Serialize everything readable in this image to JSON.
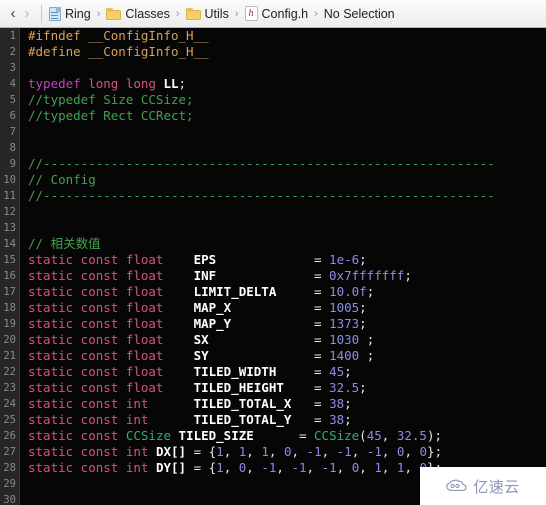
{
  "jumpbar": {
    "back_glyph": "‹",
    "forward_glyph": "›",
    "separator_glyph": "›",
    "crumbs": [
      {
        "icon": "document-icon",
        "label": "Ring"
      },
      {
        "icon": "folder-icon",
        "label": "Classes"
      },
      {
        "icon": "folder-icon",
        "label": "Utils"
      },
      {
        "icon": "header-file-icon",
        "label": "Config.h",
        "icon_letter": "h"
      },
      {
        "icon": "none",
        "label": "No Selection"
      }
    ]
  },
  "editor": {
    "first_line_number": 1,
    "line_numbers": [
      "1",
      "2",
      "3",
      "4",
      "5",
      "6",
      "7",
      "8",
      "9",
      "10",
      "11",
      "12",
      "13",
      "14",
      "15",
      "16",
      "17",
      "18",
      "19",
      "20",
      "21",
      "22",
      "23",
      "24",
      "25",
      "26",
      "27",
      "28",
      "29",
      "30"
    ],
    "lines": [
      {
        "n": "1",
        "tokens": [
          {
            "t": "#ifndef __ConfigInfo_H__",
            "c": "pre"
          }
        ]
      },
      {
        "n": "2",
        "tokens": [
          {
            "t": "#define __ConfigInfo_H__",
            "c": "pre"
          }
        ]
      },
      {
        "n": "3",
        "tokens": []
      },
      {
        "n": "4",
        "tokens": [
          {
            "t": "typedef",
            "c": "kw"
          },
          {
            "t": " ",
            "c": "plain"
          },
          {
            "t": "long long",
            "c": "type"
          },
          {
            "t": " ",
            "c": "plain"
          },
          {
            "t": "LL",
            "c": "id"
          },
          {
            "t": ";",
            "c": "plain"
          }
        ]
      },
      {
        "n": "5",
        "tokens": [
          {
            "t": "//typedef Size CCSize;",
            "c": "cmt"
          }
        ]
      },
      {
        "n": "6",
        "tokens": [
          {
            "t": "//typedef Rect CCRect;",
            "c": "cmt"
          }
        ]
      },
      {
        "n": "7",
        "tokens": []
      },
      {
        "n": "8",
        "tokens": []
      },
      {
        "n": "9",
        "tokens": [
          {
            "t": "//------------------------------------------------------------",
            "c": "cmt"
          }
        ]
      },
      {
        "n": "10",
        "tokens": [
          {
            "t": "// Config",
            "c": "cmt"
          }
        ]
      },
      {
        "n": "11",
        "tokens": [
          {
            "t": "//------------------------------------------------------------",
            "c": "cmt"
          }
        ]
      },
      {
        "n": "12",
        "tokens": []
      },
      {
        "n": "13",
        "tokens": []
      },
      {
        "n": "14",
        "tokens": [
          {
            "t": "// 相关数值",
            "c": "cmt"
          }
        ]
      },
      {
        "n": "15",
        "tokens": [
          {
            "t": "static const float",
            "c": "type"
          },
          {
            "t": "    ",
            "c": "plain"
          },
          {
            "t": "EPS",
            "c": "id"
          },
          {
            "t": "             = ",
            "c": "plain"
          },
          {
            "t": "1e-6",
            "c": "num"
          },
          {
            "t": ";",
            "c": "plain"
          }
        ]
      },
      {
        "n": "16",
        "tokens": [
          {
            "t": "static const float",
            "c": "type"
          },
          {
            "t": "    ",
            "c": "plain"
          },
          {
            "t": "INF",
            "c": "id"
          },
          {
            "t": "             = ",
            "c": "plain"
          },
          {
            "t": "0x7fffffff",
            "c": "num"
          },
          {
            "t": ";",
            "c": "plain"
          }
        ]
      },
      {
        "n": "17",
        "tokens": [
          {
            "t": "static const float",
            "c": "type"
          },
          {
            "t": "    ",
            "c": "plain"
          },
          {
            "t": "LIMIT_DELTA",
            "c": "id"
          },
          {
            "t": "     = ",
            "c": "plain"
          },
          {
            "t": "10.0f",
            "c": "num"
          },
          {
            "t": ";",
            "c": "plain"
          }
        ]
      },
      {
        "n": "18",
        "tokens": [
          {
            "t": "static const float",
            "c": "type"
          },
          {
            "t": "    ",
            "c": "plain"
          },
          {
            "t": "MAP_X",
            "c": "id"
          },
          {
            "t": "           = ",
            "c": "plain"
          },
          {
            "t": "1005",
            "c": "num"
          },
          {
            "t": ";",
            "c": "plain"
          }
        ]
      },
      {
        "n": "19",
        "tokens": [
          {
            "t": "static const float",
            "c": "type"
          },
          {
            "t": "    ",
            "c": "plain"
          },
          {
            "t": "MAP_Y",
            "c": "id"
          },
          {
            "t": "           = ",
            "c": "plain"
          },
          {
            "t": "1373",
            "c": "num"
          },
          {
            "t": ";",
            "c": "plain"
          }
        ]
      },
      {
        "n": "20",
        "tokens": [
          {
            "t": "static const float",
            "c": "type"
          },
          {
            "t": "    ",
            "c": "plain"
          },
          {
            "t": "SX",
            "c": "id"
          },
          {
            "t": "              = ",
            "c": "plain"
          },
          {
            "t": "1030",
            "c": "num"
          },
          {
            "t": " ;",
            "c": "plain"
          }
        ]
      },
      {
        "n": "21",
        "tokens": [
          {
            "t": "static const float",
            "c": "type"
          },
          {
            "t": "    ",
            "c": "plain"
          },
          {
            "t": "SY",
            "c": "id"
          },
          {
            "t": "              = ",
            "c": "plain"
          },
          {
            "t": "1400",
            "c": "num"
          },
          {
            "t": " ;",
            "c": "plain"
          }
        ]
      },
      {
        "n": "22",
        "tokens": [
          {
            "t": "static const float",
            "c": "type"
          },
          {
            "t": "    ",
            "c": "plain"
          },
          {
            "t": "TILED_WIDTH",
            "c": "id"
          },
          {
            "t": "     = ",
            "c": "plain"
          },
          {
            "t": "45",
            "c": "num"
          },
          {
            "t": ";",
            "c": "plain"
          }
        ]
      },
      {
        "n": "23",
        "tokens": [
          {
            "t": "static const float",
            "c": "type"
          },
          {
            "t": "    ",
            "c": "plain"
          },
          {
            "t": "TILED_HEIGHT",
            "c": "id"
          },
          {
            "t": "    = ",
            "c": "plain"
          },
          {
            "t": "32.5",
            "c": "num"
          },
          {
            "t": ";",
            "c": "plain"
          }
        ]
      },
      {
        "n": "24",
        "tokens": [
          {
            "t": "static const int",
            "c": "type"
          },
          {
            "t": "      ",
            "c": "plain"
          },
          {
            "t": "TILED_TOTAL_X",
            "c": "id"
          },
          {
            "t": "   = ",
            "c": "plain"
          },
          {
            "t": "38",
            "c": "num"
          },
          {
            "t": ";",
            "c": "plain"
          }
        ]
      },
      {
        "n": "25",
        "tokens": [
          {
            "t": "static const int",
            "c": "type"
          },
          {
            "t": "      ",
            "c": "plain"
          },
          {
            "t": "TILED_TOTAL_Y",
            "c": "id"
          },
          {
            "t": "   = ",
            "c": "plain"
          },
          {
            "t": "38",
            "c": "num"
          },
          {
            "t": ";",
            "c": "plain"
          }
        ]
      },
      {
        "n": "26",
        "tokens": [
          {
            "t": "static const ",
            "c": "type"
          },
          {
            "t": "CCSize",
            "c": "cls"
          },
          {
            "t": " ",
            "c": "plain"
          },
          {
            "t": "TILED_SIZE",
            "c": "id"
          },
          {
            "t": "      = ",
            "c": "plain"
          },
          {
            "t": "CCSize",
            "c": "cls"
          },
          {
            "t": "(",
            "c": "plain"
          },
          {
            "t": "45",
            "c": "num"
          },
          {
            "t": ", ",
            "c": "plain"
          },
          {
            "t": "32.5",
            "c": "num"
          },
          {
            "t": ");",
            "c": "plain"
          }
        ]
      },
      {
        "n": "27",
        "tokens": [
          {
            "t": "static const int",
            "c": "type"
          },
          {
            "t": " ",
            "c": "plain"
          },
          {
            "t": "DX[]",
            "c": "id"
          },
          {
            "t": " = {",
            "c": "plain"
          },
          {
            "t": "1",
            "c": "num"
          },
          {
            "t": ", ",
            "c": "plain"
          },
          {
            "t": "1",
            "c": "num"
          },
          {
            "t": ", ",
            "c": "plain"
          },
          {
            "t": "1",
            "c": "num"
          },
          {
            "t": ", ",
            "c": "plain"
          },
          {
            "t": "0",
            "c": "num"
          },
          {
            "t": ", ",
            "c": "plain"
          },
          {
            "t": "-1",
            "c": "num"
          },
          {
            "t": ", ",
            "c": "plain"
          },
          {
            "t": "-1",
            "c": "num"
          },
          {
            "t": ", ",
            "c": "plain"
          },
          {
            "t": "-1",
            "c": "num"
          },
          {
            "t": ", ",
            "c": "plain"
          },
          {
            "t": "0",
            "c": "num"
          },
          {
            "t": ", ",
            "c": "plain"
          },
          {
            "t": "0",
            "c": "num"
          },
          {
            "t": "};",
            "c": "plain"
          }
        ]
      },
      {
        "n": "28",
        "tokens": [
          {
            "t": "static const int",
            "c": "type"
          },
          {
            "t": " ",
            "c": "plain"
          },
          {
            "t": "DY[]",
            "c": "id"
          },
          {
            "t": " = {",
            "c": "plain"
          },
          {
            "t": "1",
            "c": "num"
          },
          {
            "t": ", ",
            "c": "plain"
          },
          {
            "t": "0",
            "c": "num"
          },
          {
            "t": ", ",
            "c": "plain"
          },
          {
            "t": "-1",
            "c": "num"
          },
          {
            "t": ", ",
            "c": "plain"
          },
          {
            "t": "-1",
            "c": "num"
          },
          {
            "t": ", ",
            "c": "plain"
          },
          {
            "t": "-1",
            "c": "num"
          },
          {
            "t": ", ",
            "c": "plain"
          },
          {
            "t": "0",
            "c": "num"
          },
          {
            "t": ", ",
            "c": "plain"
          },
          {
            "t": "1",
            "c": "num"
          },
          {
            "t": ", ",
            "c": "plain"
          },
          {
            "t": "1",
            "c": "num"
          },
          {
            "t": ", ",
            "c": "plain"
          },
          {
            "t": "0",
            "c": "num"
          },
          {
            "t": "};",
            "c": "plain"
          }
        ]
      },
      {
        "n": "29",
        "tokens": []
      },
      {
        "n": "30",
        "tokens": []
      }
    ]
  },
  "watermark": {
    "text": "亿速云"
  },
  "colors": {
    "editor_background": "#060606",
    "gutter_background": "#262626",
    "preprocessor": "#d9a05b",
    "comment": "#3fa34d",
    "keyword": "#c43ec4",
    "type": "#d8527c",
    "class_name": "#2fb170",
    "identifier": "#ffffff",
    "number": "#8a8ce8"
  }
}
